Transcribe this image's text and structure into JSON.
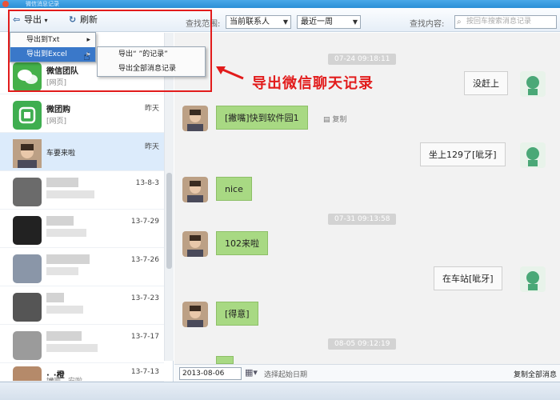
{
  "window": {
    "title": "微信消息记录"
  },
  "toolbar": {
    "export_label": "导出",
    "refresh_label": "刷新",
    "range_label": "查找范围:",
    "range_value": "当前联系人",
    "period_value": "最近一周",
    "content_label": "查找内容:",
    "search_placeholder": "按回车搜索消息记录"
  },
  "export_menu": {
    "items": [
      "导出到Txt",
      "导出到Excel"
    ],
    "submenu": [
      "导出“   ”的记录”",
      "导出全部消息记录"
    ]
  },
  "annotation": {
    "text": "导出微信聊天记录"
  },
  "contacts": [
    {
      "name": "微信团队",
      "sub": "[网页]",
      "date": ""
    },
    {
      "name": "微团购",
      "sub": "[网页]",
      "date": "昨天"
    },
    {
      "name": "",
      "sub": "车要来啦",
      "date": "昨天"
    },
    {
      "name": "",
      "sub": "",
      "date": "13-8-3"
    },
    {
      "name": "",
      "sub": "",
      "date": "13-7-29"
    },
    {
      "name": "",
      "sub": "",
      "date": "13-7-26"
    },
    {
      "name": "",
      "sub": "",
      "date": "13-7-23"
    },
    {
      "name": "",
      "sub": "",
      "date": "13-7-17"
    },
    {
      "name": "·_·橙",
      "sub": "好啊，安啦",
      "date": "13-7-13"
    }
  ],
  "messages": [
    {
      "kind": "time",
      "text": "07-24 09:18:11"
    },
    {
      "kind": "out",
      "text": "没赶上"
    },
    {
      "kind": "in",
      "text": "[撇嘴]快到软件园1",
      "copy": "复制"
    },
    {
      "kind": "out",
      "text": "坐上129了[呲牙]"
    },
    {
      "kind": "in",
      "text": "nice"
    },
    {
      "kind": "time",
      "text": "07-31 09:13:58"
    },
    {
      "kind": "in",
      "text": "102来啦"
    },
    {
      "kind": "out",
      "text": "在车站[呲牙]"
    },
    {
      "kind": "in",
      "text": "[得意]"
    },
    {
      "kind": "time",
      "text": "08-05 09:12:19"
    }
  ],
  "footer": {
    "date_value": "2013-08-06",
    "pick_label": "选择起始日期",
    "copy_all_label": "复制全部消息"
  },
  "colors": {
    "bubble_in": "#a8d983",
    "annotation": "#e21c1c",
    "accent": "#3a78c9"
  }
}
